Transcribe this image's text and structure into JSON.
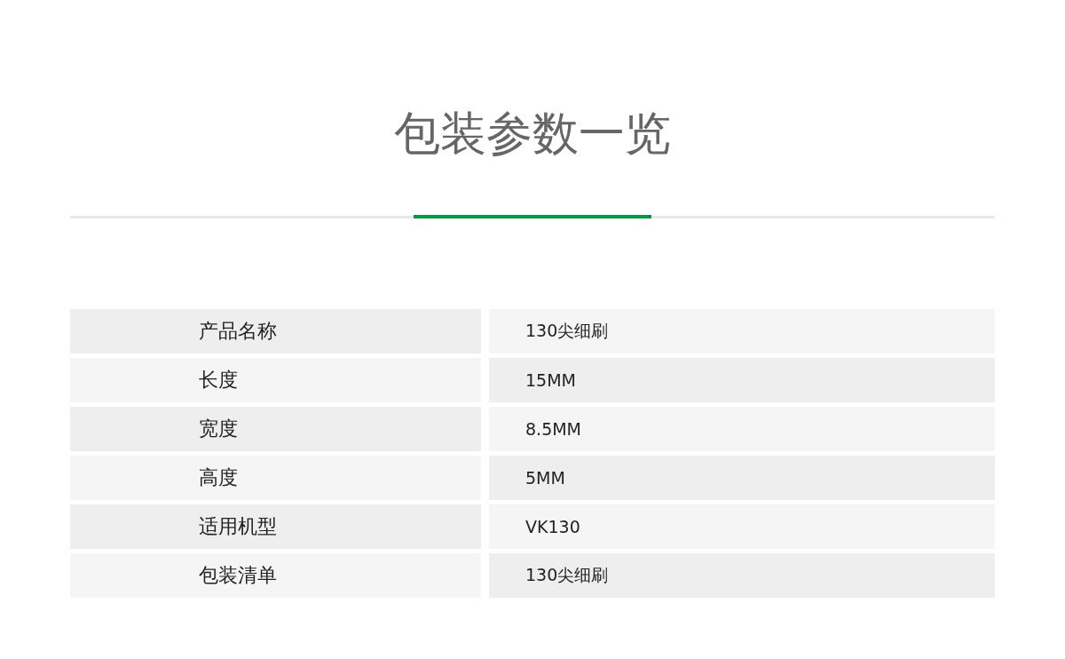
{
  "title": "包装参数一览",
  "rows": [
    {
      "label": "产品名称",
      "value": "130尖细刷"
    },
    {
      "label": "长度",
      "value": "15MM"
    },
    {
      "label": "宽度",
      "value": "8.5MM"
    },
    {
      "label": "高度",
      "value": "5MM"
    },
    {
      "label": "适用机型",
      "value": "VK130"
    },
    {
      "label": "包装清单",
      "value": "130尖细刷"
    }
  ]
}
